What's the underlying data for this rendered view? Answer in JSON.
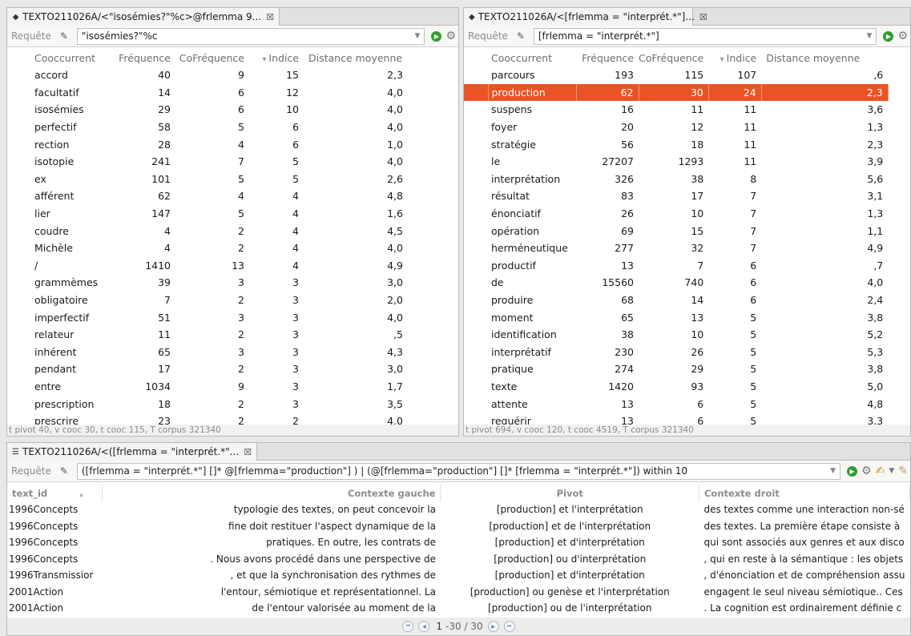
{
  "left": {
    "tab_title": "TEXTO211026A/<\"isosémies?\"%c>@frlemma 9...",
    "tab_close": "☒",
    "query_label": "Requête",
    "query": "\"isosémies?\"%c",
    "columns": [
      "Cooccurrent",
      "Fréquence",
      "CoFréquence",
      "Indice",
      "Distance moyenne"
    ],
    "sort_marker": "▾",
    "rows": [
      [
        "accord",
        "40",
        "9",
        "15",
        "2,3"
      ],
      [
        "facultatif",
        "14",
        "6",
        "12",
        "4,0"
      ],
      [
        "isosémies",
        "29",
        "6",
        "10",
        "4,0"
      ],
      [
        "perfectif",
        "58",
        "5",
        "6",
        "4,0"
      ],
      [
        "rection",
        "28",
        "4",
        "6",
        "1,0"
      ],
      [
        "isotopie",
        "241",
        "7",
        "5",
        "4,0"
      ],
      [
        "ex",
        "101",
        "5",
        "5",
        "2,6"
      ],
      [
        "afférent",
        "62",
        "4",
        "4",
        "4,8"
      ],
      [
        "lier",
        "147",
        "5",
        "4",
        "1,6"
      ],
      [
        "coudre",
        "4",
        "2",
        "4",
        "4,5"
      ],
      [
        "Michèle",
        "4",
        "2",
        "4",
        "4,0"
      ],
      [
        "/",
        "1410",
        "13",
        "4",
        "4,9"
      ],
      [
        "grammèmes",
        "39",
        "3",
        "3",
        "3,0"
      ],
      [
        "obligatoire",
        "7",
        "2",
        "3",
        "2,0"
      ],
      [
        "imperfectif",
        "51",
        "3",
        "3",
        "4,0"
      ],
      [
        "relateur",
        "11",
        "2",
        "3",
        ",5"
      ],
      [
        "inhérent",
        "65",
        "3",
        "3",
        "4,3"
      ],
      [
        "pendant",
        "17",
        "2",
        "3",
        "3,0"
      ],
      [
        "entre",
        "1034",
        "9",
        "3",
        "1,7"
      ],
      [
        "prescription",
        "18",
        "2",
        "3",
        "3,5"
      ],
      [
        "prescrire",
        "23",
        "2",
        "2",
        "4,0"
      ]
    ],
    "status": "t pivot 40, v cooc 30, t cooc 115, T corpus 321340"
  },
  "right": {
    "tab_title": "TEXTO211026A/<[frlemma = \"interprét.*\"]... ",
    "tab_close": "☒",
    "query_label": "Requête",
    "query": "[frlemma = \"interprét.*\"]",
    "columns": [
      "Cooccurrent",
      "Fréquence",
      "CoFréquence",
      "Indice",
      "Distance moyenne"
    ],
    "sort_marker": "▾",
    "rows": [
      [
        "parcours",
        "193",
        "115",
        "107",
        ",6"
      ],
      [
        "production",
        "62",
        "30",
        "24",
        "2,3"
      ],
      [
        "suspens",
        "16",
        "11",
        "11",
        "3,6"
      ],
      [
        "foyer",
        "20",
        "12",
        "11",
        "1,3"
      ],
      [
        "stratégie",
        "56",
        "18",
        "11",
        "2,3"
      ],
      [
        "le",
        "27207",
        "1293",
        "11",
        "3,9"
      ],
      [
        "interprétation",
        "326",
        "38",
        "8",
        "5,6"
      ],
      [
        "résultat",
        "83",
        "17",
        "7",
        "3,1"
      ],
      [
        "énonciatif",
        "26",
        "10",
        "7",
        "1,3"
      ],
      [
        "opération",
        "69",
        "15",
        "7",
        "1,1"
      ],
      [
        "herméneutique",
        "277",
        "32",
        "7",
        "4,9"
      ],
      [
        "productif",
        "13",
        "7",
        "6",
        ",7"
      ],
      [
        "de",
        "15560",
        "740",
        "6",
        "4,0"
      ],
      [
        "produire",
        "68",
        "14",
        "6",
        "2,4"
      ],
      [
        "moment",
        "65",
        "13",
        "5",
        "3,8"
      ],
      [
        "identification",
        "38",
        "10",
        "5",
        "5,2"
      ],
      [
        "interprétatif",
        "230",
        "26",
        "5",
        "5,3"
      ],
      [
        "pratique",
        "274",
        "29",
        "5",
        "3,8"
      ],
      [
        "texte",
        "1420",
        "93",
        "5",
        "5,0"
      ],
      [
        "attente",
        "13",
        "6",
        "5",
        "4,8"
      ],
      [
        "requérir",
        "13",
        "6",
        "5",
        "3,3"
      ]
    ],
    "selected_row": 1,
    "status": "t pivot 694, v cooc 120, t cooc 4519, T corpus 321340"
  },
  "bottom": {
    "tab_title": "TEXTO211026A/<([frlemma = \"interprét.*\"... ",
    "tab_close": "☒",
    "query_label": "Requête",
    "query": "([frlemma = \"interprét.*\"] []* @[frlemma=\"production\"] ) | (@[frlemma=\"production\"]  []* [frlemma = \"interprét.*\"]) within 10",
    "columns": [
      "text_id",
      "Contexte gauche",
      "Pivot",
      "Contexte droit"
    ],
    "sort_marker": "▴",
    "rows": [
      [
        "1996Concepts",
        "typologie des textes, on peut concevoir la",
        "[production] et l'interprétation",
        "des textes comme une interaction non-sé"
      ],
      [
        "1996Concepts",
        "fine doit restituer l'aspect dynamique de la",
        "[production] et de l'interprétation",
        "des textes. La première étape consiste à"
      ],
      [
        "1996Concepts",
        "pratiques. En outre, les contrats de",
        "[production] et d'interprétation",
        "qui sont associés aux genres et aux disco"
      ],
      [
        "1996Concepts",
        ". Nous avons procédé dans une perspective de",
        "[production] ou d'interprétation",
        ", qui en reste à la sémantique : les objets"
      ],
      [
        "1996Transmissior",
        ", et que la synchronisation des rythmes de",
        "[production] et d'interprétation",
        ", d'énonciation et de compréhension assu"
      ],
      [
        "2001Action",
        "l'entour, sémiotique et représentationnel. La",
        "[production] ou genèse et l'interprétation",
        "engagent le seul niveau sémiotique.. Ces"
      ],
      [
        "2001Action",
        "de l'entour valorisée au moment de la",
        "[production] ou de l'interprétation",
        ". La cognition est ordinairement définie c"
      ]
    ],
    "pager": {
      "current": "1",
      "range": "-30 / 30"
    }
  }
}
